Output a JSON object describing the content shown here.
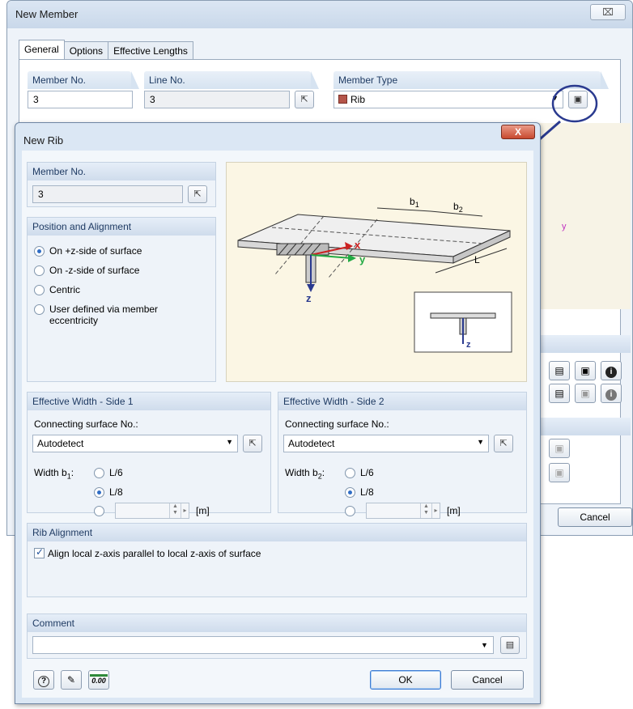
{
  "back_dialog": {
    "title": "New Member",
    "close_glyph": "⌧",
    "tabs": [
      "General",
      "Options",
      "Effective Lengths"
    ],
    "member_no_label": "Member No.",
    "member_no": "3",
    "line_no_label": "Line No.",
    "line_no": "3",
    "member_type_label": "Member Type",
    "member_type": "Rib",
    "cancel_label": "Cancel",
    "y_axis": "y"
  },
  "front_dialog": {
    "title": "New Rib",
    "close_glyph": "X",
    "member_no_label": "Member No.",
    "member_no": "3",
    "position": {
      "header": "Position and Alignment",
      "options": [
        "On +z-side of surface",
        "On -z-side of surface",
        "Centric",
        "User defined via member eccentricity"
      ],
      "selected": 0
    },
    "diagram": {
      "b1": "b",
      "b1_sub": "1",
      "b2": "b",
      "b2_sub": "2",
      "L": "L",
      "x": "x",
      "y": "y",
      "z": "z",
      "inset_z": "z"
    },
    "side1": {
      "header": "Effective Width - Side 1",
      "conn_label": "Connecting surface No.:",
      "conn_value": "Autodetect",
      "width_label": "Width b",
      "width_sub": "1",
      "opt1": "L/6",
      "opt2": "L/8",
      "unit": "[m]"
    },
    "side2": {
      "header": "Effective Width - Side 2",
      "conn_label": "Connecting surface No.:",
      "conn_value": "Autodetect",
      "width_label": "Width b",
      "width_sub": "2",
      "opt1": "L/6",
      "opt2": "L/8",
      "unit": "[m]"
    },
    "rib_alignment": {
      "header": "Rib Alignment",
      "checkbox_label": "Align local z-axis parallel to local z-axis of surface",
      "checked": true
    },
    "comment": {
      "header": "Comment",
      "value": ""
    },
    "ok_label": "OK",
    "cancel_label": "Cancel",
    "units_icon_text": "0.00"
  },
  "colors": {
    "accent_blue": "#2a3a8f",
    "header_text": "#1f3b63",
    "rib_swatch": "#b4554a",
    "x_axis": "#cc2222",
    "y_axis": "#22aa44",
    "z_axis": "#2a3a8f"
  }
}
